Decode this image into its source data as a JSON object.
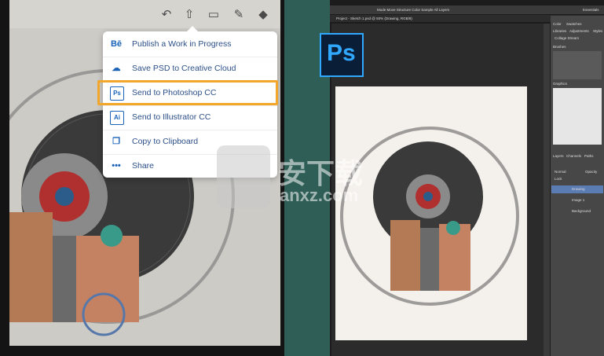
{
  "ipad": {
    "toolbar_icons": [
      "undo-icon",
      "share-icon",
      "image-icon",
      "pen-icon",
      "layers-icon"
    ],
    "share_menu": {
      "items": [
        {
          "label": "Publish a Work in Progress",
          "icon": "Bē"
        },
        {
          "label": "Save PSD to Creative Cloud",
          "icon": "cc-icon"
        },
        {
          "label": "Send to Photoshop CC",
          "icon": "Ps"
        },
        {
          "label": "Send to Illustrator CC",
          "icon": "Ai"
        },
        {
          "label": "Copy to Clipboard",
          "icon": "copy-icon"
        },
        {
          "label": "Share",
          "icon": "•••"
        }
      ],
      "highlighted_index": 2
    }
  },
  "photoshop": {
    "logo_text": "Ps",
    "menu_left": "Mode Move Structure Color Sample All Layers",
    "workspace": "Essentials",
    "doc_tab": "Project - Sketch 1.psd @ 50% (Drawing, RGB/8)",
    "panel_tabs": [
      "Color",
      "Swatches",
      "Libraries",
      "Adjustments",
      "Styles"
    ],
    "library_name": "Collage Stream",
    "brushes_label": "Brushes",
    "graphics_label": "Graphics",
    "layers_tabs": [
      "Layers",
      "Channels",
      "Paths"
    ],
    "blend_mode": "Normal",
    "opacity_label": "Opacity",
    "lock_label": "Lock",
    "layers": [
      "Drawing",
      "Image 1",
      "Background"
    ]
  },
  "watermark": {
    "text": "安下载",
    "sub": "anxz.com"
  }
}
